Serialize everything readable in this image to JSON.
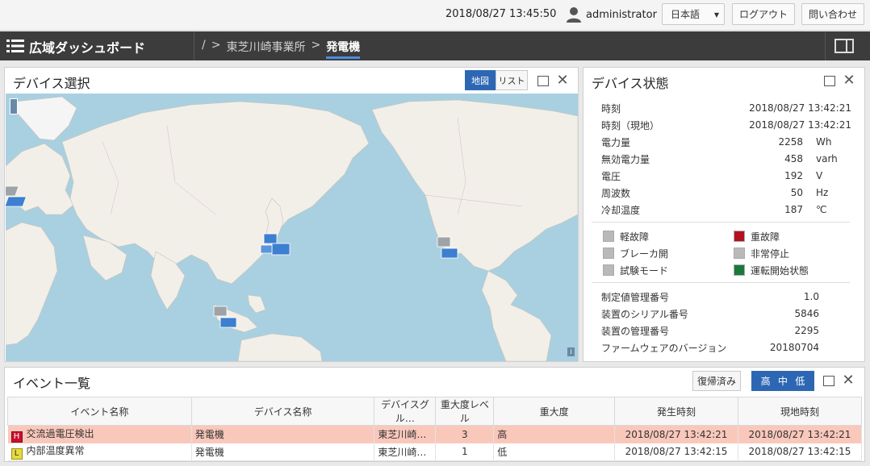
{
  "topbar": {
    "datetime": "2018/08/27 13:45:50",
    "user": "administrator",
    "language": "日本語",
    "logout": "ログアウト",
    "contact": "問い合わせ"
  },
  "nav": {
    "title": "広域ダッシュボード",
    "breadcrumb": [
      "/",
      ">",
      "東芝川崎事業所",
      ">"
    ],
    "current": "発電機"
  },
  "device_select": {
    "title": "デバイス選択",
    "tab_map": "地図",
    "tab_list": "リスト"
  },
  "device_state": {
    "title": "デバイス状態",
    "rows": [
      {
        "label": "時刻",
        "value": "2018/08/27 13:42:21",
        "unit": ""
      },
      {
        "label": "時刻（現地）",
        "value": "2018/08/27 13:42:21",
        "unit": ""
      },
      {
        "label": "電力量",
        "value": "2258",
        "unit": "Wh"
      },
      {
        "label": "無効電力量",
        "value": "458",
        "unit": "varh"
      },
      {
        "label": "電圧",
        "value": "192",
        "unit": "V"
      },
      {
        "label": "周波数",
        "value": "50",
        "unit": "Hz"
      },
      {
        "label": "冷却温度",
        "value": "187",
        "unit": "℃"
      }
    ],
    "indicators": [
      {
        "label": "軽故障",
        "color": "#b9b9b9"
      },
      {
        "label": "重故障",
        "color": "#b5101f"
      },
      {
        "label": "ブレーカ開",
        "color": "#b9b9b9"
      },
      {
        "label": "非常停止",
        "color": "#b9b9b9"
      },
      {
        "label": "試験モード",
        "color": "#b9b9b9"
      },
      {
        "label": "運転開始状態",
        "color": "#1a7a3a"
      }
    ],
    "info": [
      {
        "label": "制定値管理番号",
        "value": "1.0"
      },
      {
        "label": "装置のシリアル番号",
        "value": "5846"
      },
      {
        "label": "装置の管理番号",
        "value": "2295"
      },
      {
        "label": "ファームウェアのバージョン",
        "value": "20180704"
      }
    ]
  },
  "events": {
    "title": "イベント一覧",
    "restored_btn": "復帰済み",
    "levels": [
      "高",
      "中",
      "低"
    ],
    "columns": [
      "イベント名称",
      "デバイス名称",
      "デバイスグル…",
      "重大度レベル",
      "重大度",
      "発生時刻",
      "現地時刻"
    ],
    "rows": [
      {
        "badge": "H",
        "name": "交流過電圧検出",
        "device": "発電機",
        "group": "東芝川崎…",
        "level": "3",
        "severity": "高",
        "time": "2018/08/27 13:42:21",
        "local": "2018/08/27 13:42:21"
      },
      {
        "badge": "L",
        "name": "内部温度異常",
        "device": "発電機",
        "group": "東芝川崎…",
        "level": "1",
        "severity": "低",
        "time": "2018/08/27 13:42:15",
        "local": "2018/08/27 13:42:15"
      }
    ]
  }
}
